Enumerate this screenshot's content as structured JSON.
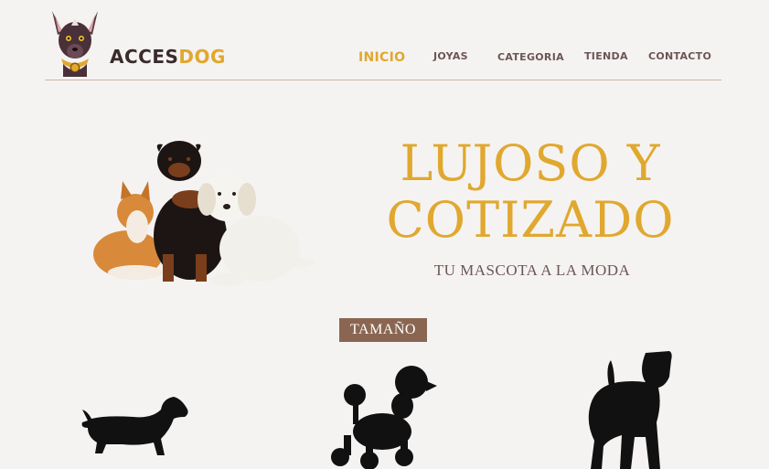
{
  "brand": {
    "part1": "ACCES",
    "part2": "DOG"
  },
  "nav": {
    "inicio": "INICIO",
    "joyas": "JOYAS",
    "categoria": "CATEGORIA",
    "tienda": "TIENDA",
    "contacto": "CONTACTO"
  },
  "hero": {
    "headline_line1": "LUJOSO Y",
    "headline_line2": "COTIZADO",
    "subtitle": "TU MASCOTA A LA MODA"
  },
  "sizes": {
    "badge": "TAMAÑO"
  },
  "colors": {
    "accent": "#e0a82e",
    "text": "#6b5655",
    "badge": "#8a6652",
    "background": "#f5f3f2"
  }
}
